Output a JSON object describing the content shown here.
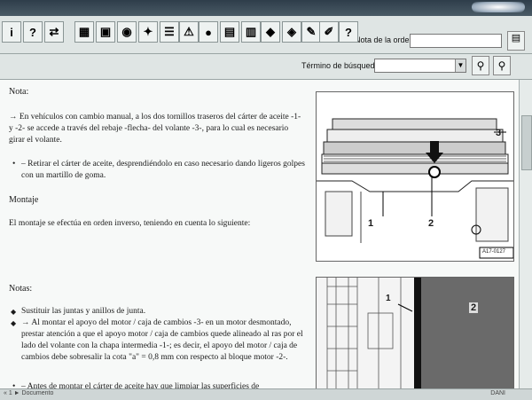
{
  "toolbar": {
    "buttons": [
      {
        "icon": "info-icon",
        "glyph": "i"
      },
      {
        "icon": "help-icon",
        "glyph": "?"
      },
      {
        "icon": "swap-arrows-icon",
        "glyph": "⇄"
      },
      {
        "icon": "engine-icon",
        "glyph": "▦"
      },
      {
        "icon": "grid-icon",
        "glyph": "▣"
      },
      {
        "icon": "database-icon",
        "glyph": "◉"
      },
      {
        "icon": "tools-icon",
        "glyph": "✦"
      },
      {
        "icon": "list-icon",
        "glyph": "☰"
      },
      {
        "icon": "warning-icon",
        "glyph": "⚠"
      },
      {
        "icon": "globe-icon",
        "glyph": "●"
      },
      {
        "icon": "book-icon",
        "glyph": "▤"
      },
      {
        "icon": "books-icon",
        "glyph": "▥"
      },
      {
        "icon": "car-icon",
        "glyph": "◆"
      },
      {
        "icon": "car-service-icon",
        "glyph": "◈"
      },
      {
        "icon": "clipboard-icon",
        "glyph": "✎"
      },
      {
        "icon": "notes-icon",
        "glyph": "✐"
      },
      {
        "icon": "document-help-icon",
        "glyph": "?"
      }
    ],
    "order_label": "Nota de la orden:",
    "order_value": ""
  },
  "search": {
    "label": "Término de búsqueda:",
    "value": ""
  },
  "content": {
    "nota_heading": "Nota:",
    "nota_text": "→ En vehículos con cambio manual, a los dos tornillos traseros del cárter de aceite -1- y -2- se accede a través del rebaje -flecha- del volante -3-, para lo cual es necesario girar el volante.",
    "nota_bullet": "– Retirar el cárter de aceite, desprendiéndolo en caso necesario dando ligeros golpes con un martillo de goma.",
    "montaje_heading": "Montaje",
    "montaje_text": "El montaje se efectúa en orden inverso, teniendo en cuenta lo siguiente:",
    "notas_heading": "Notas:",
    "notas_bullets": [
      "Sustituir las juntas y anillos de junta.",
      "→ Al montar el apoyo del motor / caja de cambios -3- en un motor desmontado, prestar atención a que el apoyo motor / caja de cambios quede alineado al ras por el lado del volante con la chapa intermedia -1-; es decir, el apoyo del motor / caja de cambios debe sobresalir la cota \"a\" = 0,8 mm con respecto al bloque motor -2-.",
      "– Antes de montar el cárter de aceite hay que limpiar las superficies de"
    ]
  },
  "figure1": {
    "label1": "1",
    "label2": "2",
    "label3": "3",
    "code": "A17-0127"
  },
  "figure2": {
    "label1": "1",
    "label2": "2"
  },
  "status": {
    "left": "« 1 ► Documento",
    "right": "DANI"
  }
}
